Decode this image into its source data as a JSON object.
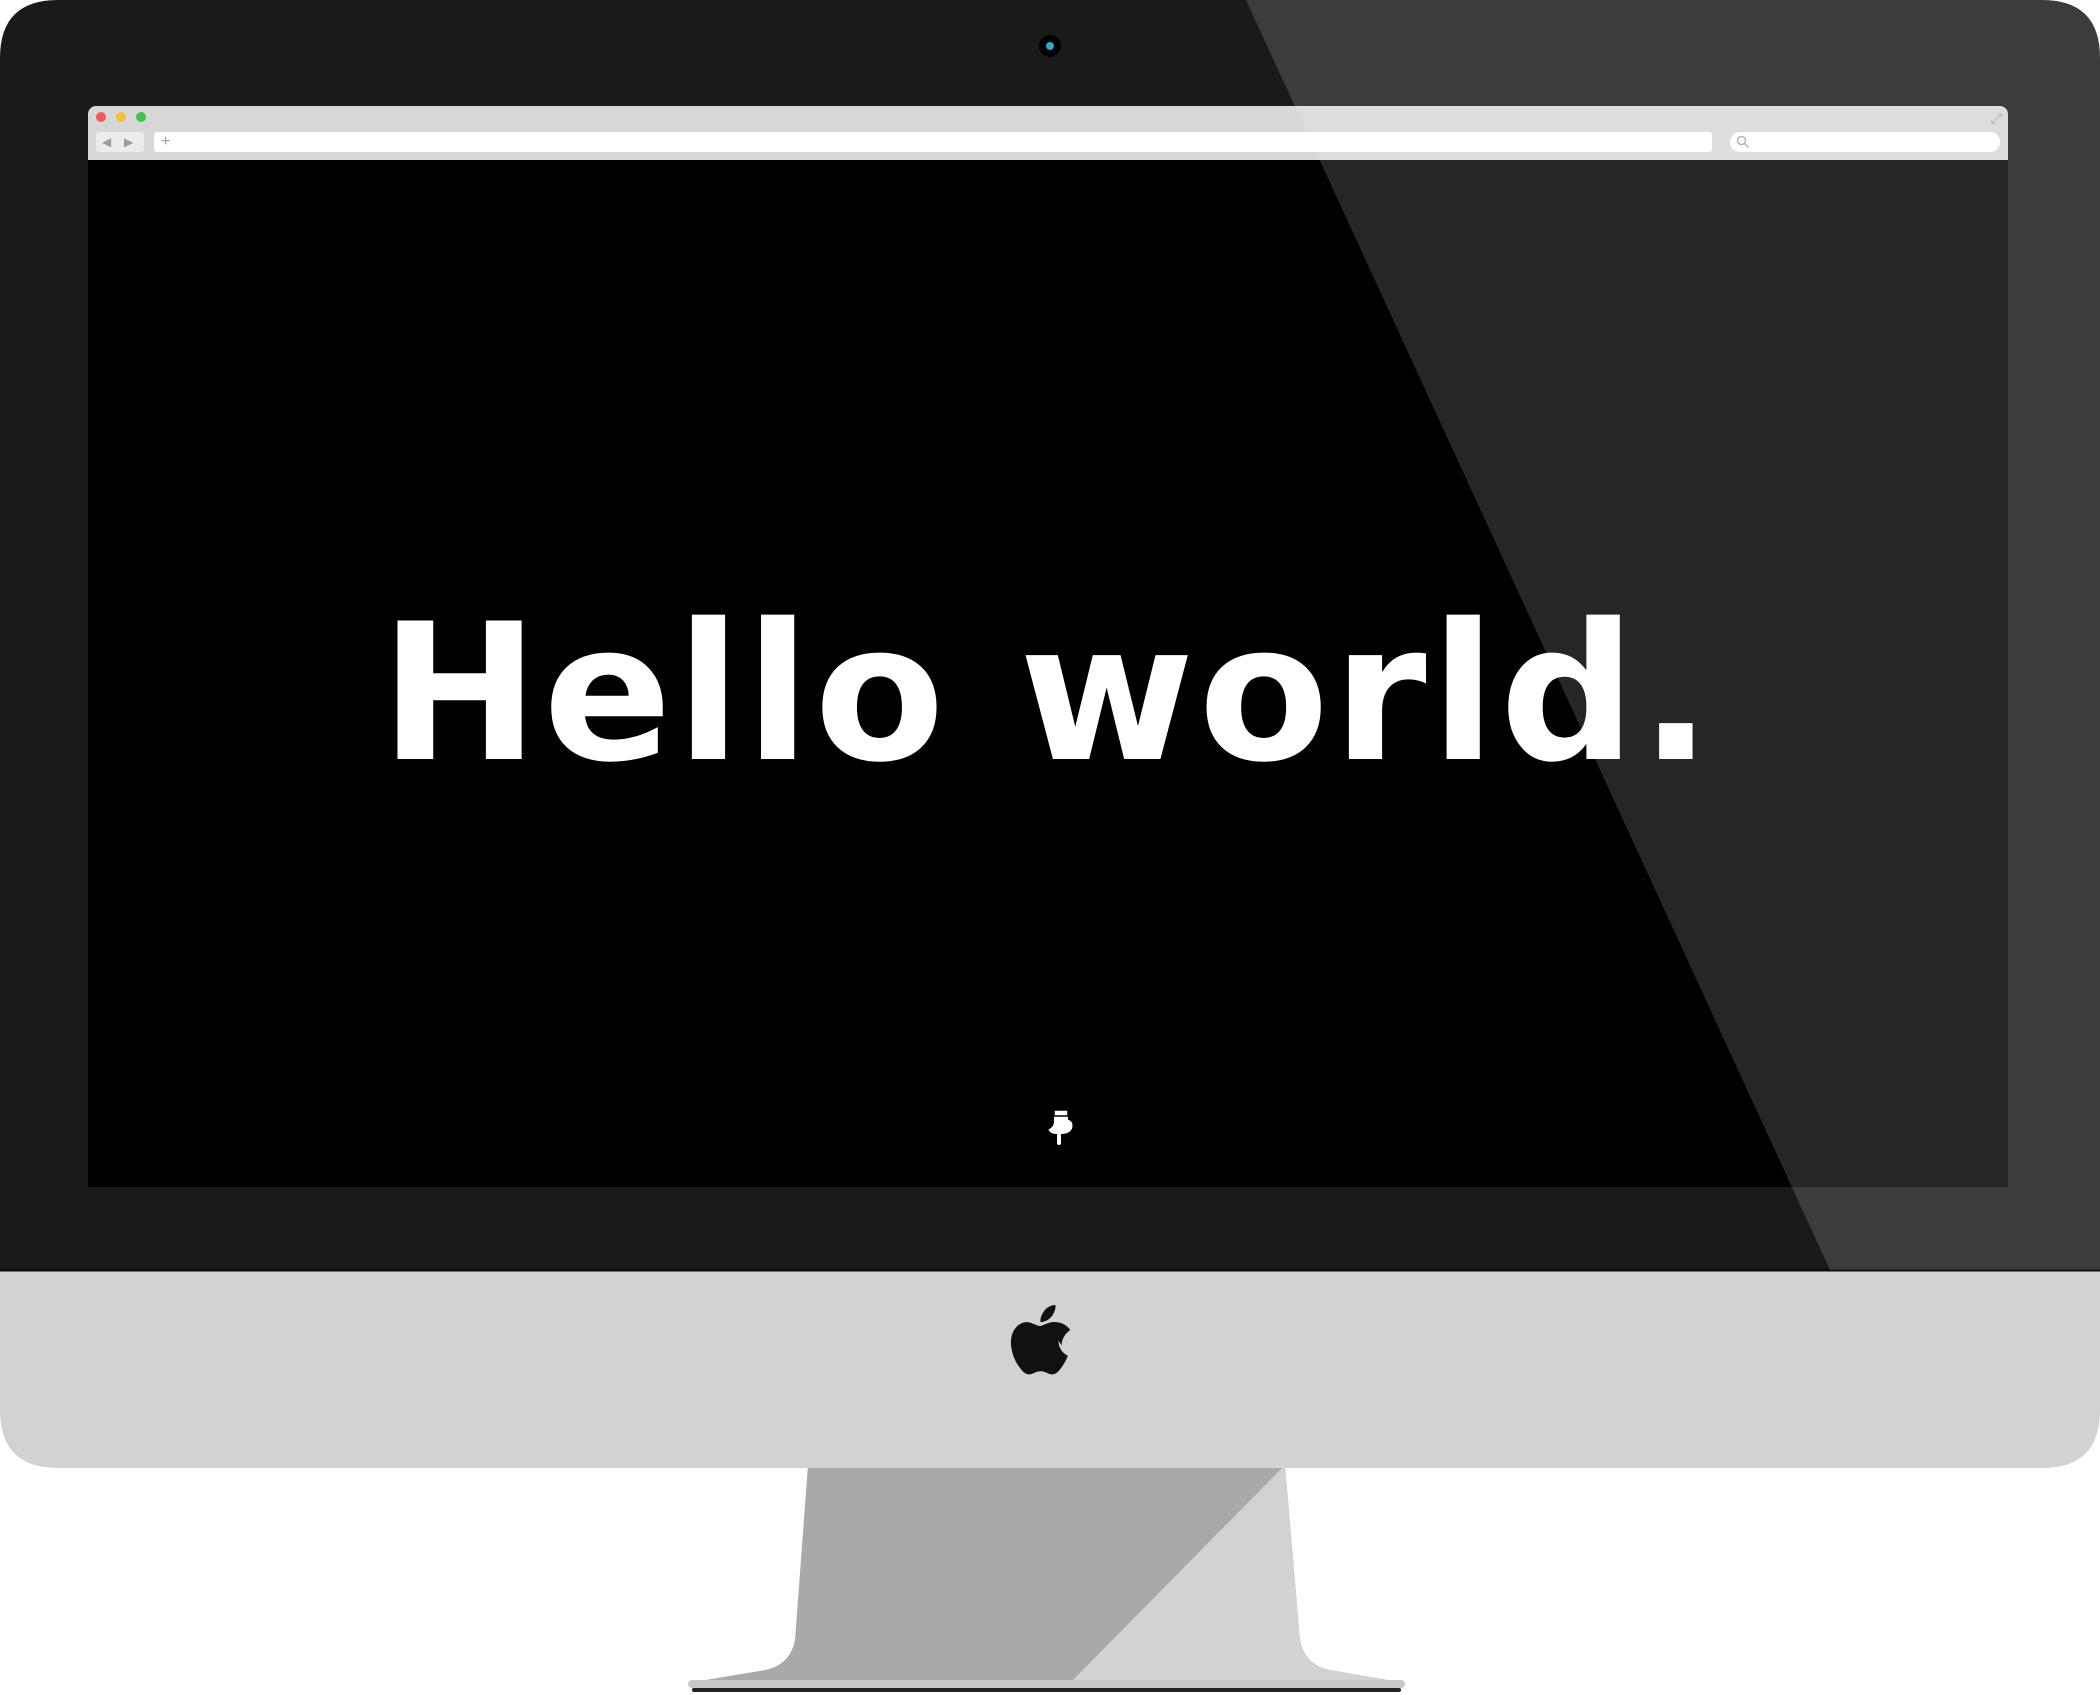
{
  "browser": {
    "back_icon": "◀",
    "forward_icon": "▶",
    "new_tab_icon": "+",
    "fullscreen_icon": "⤢",
    "address_value": "",
    "search_value": ""
  },
  "page": {
    "headline": "Hello world."
  },
  "colors": {
    "bezel": "#1a1a1a",
    "chin": "#d1d2d4",
    "stand": "#a7a9ab",
    "screen": "#000000",
    "close": "#ee5b57",
    "minimize": "#f4bd3a",
    "maximize": "#3ec449"
  }
}
